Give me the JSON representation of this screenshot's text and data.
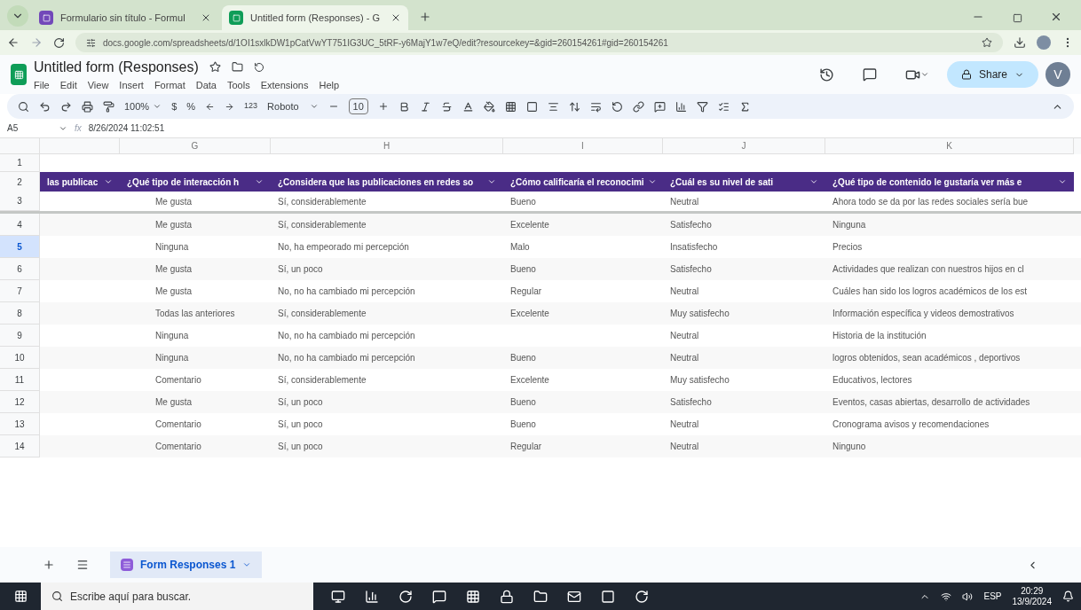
{
  "browser": {
    "tabs": [
      {
        "title": "Formulario sin título - Formul",
        "selected": false
      },
      {
        "title": "Untitled form (Responses) - G",
        "selected": true
      }
    ],
    "url": "docs.google.com/spreadsheets/d/1OI1sxlkDW1pCatVwYT751IG3UC_5tRF-y6MajY1w7eQ/edit?resourcekey=&gid=260154261#gid=260154261"
  },
  "doc": {
    "title": "Untitled form (Responses)",
    "menu": [
      "File",
      "Edit",
      "View",
      "Insert",
      "Format",
      "Data",
      "Tools",
      "Extensions",
      "Help"
    ],
    "share": "Share",
    "avatar": "V"
  },
  "toolbar": {
    "zoom": "100%",
    "currency": "$",
    "percent": "%",
    "number_format": "123",
    "font": "Roboto",
    "font_size": "10"
  },
  "formula_bar": {
    "cell": "A5",
    "fx": "fx",
    "value": "8/26/2024 11:02:51"
  },
  "grid": {
    "columns": [
      "G",
      "H",
      "I",
      "J",
      "K"
    ],
    "first_row": "1",
    "header_row": "2",
    "headers": [
      "las publicac",
      "¿Qué tipo de interacción h",
      "¿Considera que las publicaciones en redes so",
      "¿Cómo calificaría el reconocimi",
      "¿Cuál es su nivel de sati",
      "¿Qué tipo de contenido le gustaría ver más e"
    ],
    "rows": [
      {
        "num": "3",
        "selected": false,
        "cells": [
          "",
          "Me gusta",
          "Sí, considerablemente",
          "Bueno",
          "Neutral",
          "Ahora todo se da por las redes sociales sería bue"
        ]
      },
      {
        "num": "4",
        "selected": false,
        "cells": [
          "",
          "Me gusta",
          "Sí, considerablemente",
          "Excelente",
          "Satisfecho",
          "Ninguna"
        ]
      },
      {
        "num": "5",
        "selected": true,
        "cells": [
          "",
          "Ninguna",
          "No, ha empeorado mi percepción",
          "Malo",
          "Insatisfecho",
          "Precios"
        ]
      },
      {
        "num": "6",
        "selected": false,
        "cells": [
          "",
          "Me gusta",
          "Sí, un poco",
          "Bueno",
          "Satisfecho",
          "Actividades que realizan con nuestros hijos en cl"
        ]
      },
      {
        "num": "7",
        "selected": false,
        "cells": [
          "",
          "Me gusta",
          "No, no ha cambiado mi percepción",
          "Regular",
          "Neutral",
          "Cuáles han sido los logros académicos de los est"
        ]
      },
      {
        "num": "8",
        "selected": false,
        "cells": [
          "",
          "Todas las anteriores",
          "Sí, considerablemente",
          "Excelente",
          "Muy satisfecho",
          "Información específica y videos demostrativos"
        ]
      },
      {
        "num": "9",
        "selected": false,
        "cells": [
          "",
          "Ninguna",
          "No, no ha cambiado mi percepción",
          "",
          "Neutral",
          "Historia de la institución"
        ]
      },
      {
        "num": "10",
        "selected": false,
        "cells": [
          "",
          "Ninguna",
          "No, no ha cambiado mi percepción",
          "Bueno",
          "Neutral",
          "logros obtenidos, sean académicos , deportivos"
        ]
      },
      {
        "num": "11",
        "selected": false,
        "cells": [
          "",
          "Comentario",
          "Sí, considerablemente",
          "Excelente",
          "Muy satisfecho",
          "Educativos, lectores"
        ]
      },
      {
        "num": "12",
        "selected": false,
        "cells": [
          "",
          "Me gusta",
          "Sí, un poco",
          "Bueno",
          "Satisfecho",
          "Eventos, casas abiertas, desarrollo de actividades"
        ]
      },
      {
        "num": "13",
        "selected": false,
        "cells": [
          "",
          "Comentario",
          "Sí, un poco",
          "Bueno",
          "Neutral",
          "Cronograma avisos y recomendaciones"
        ]
      },
      {
        "num": "14",
        "selected": false,
        "cells": [
          "",
          "Comentario",
          "Sí, un poco",
          "Regular",
          "Neutral",
          "Ninguno"
        ]
      }
    ]
  },
  "sheet_tabs": [
    {
      "name": "Form Responses 1",
      "selected": true
    }
  ],
  "taskbar": {
    "search_placeholder": "Escribe aquí para buscar.",
    "language": "ESP",
    "time": "20:29",
    "date": "13/9/2024"
  }
}
